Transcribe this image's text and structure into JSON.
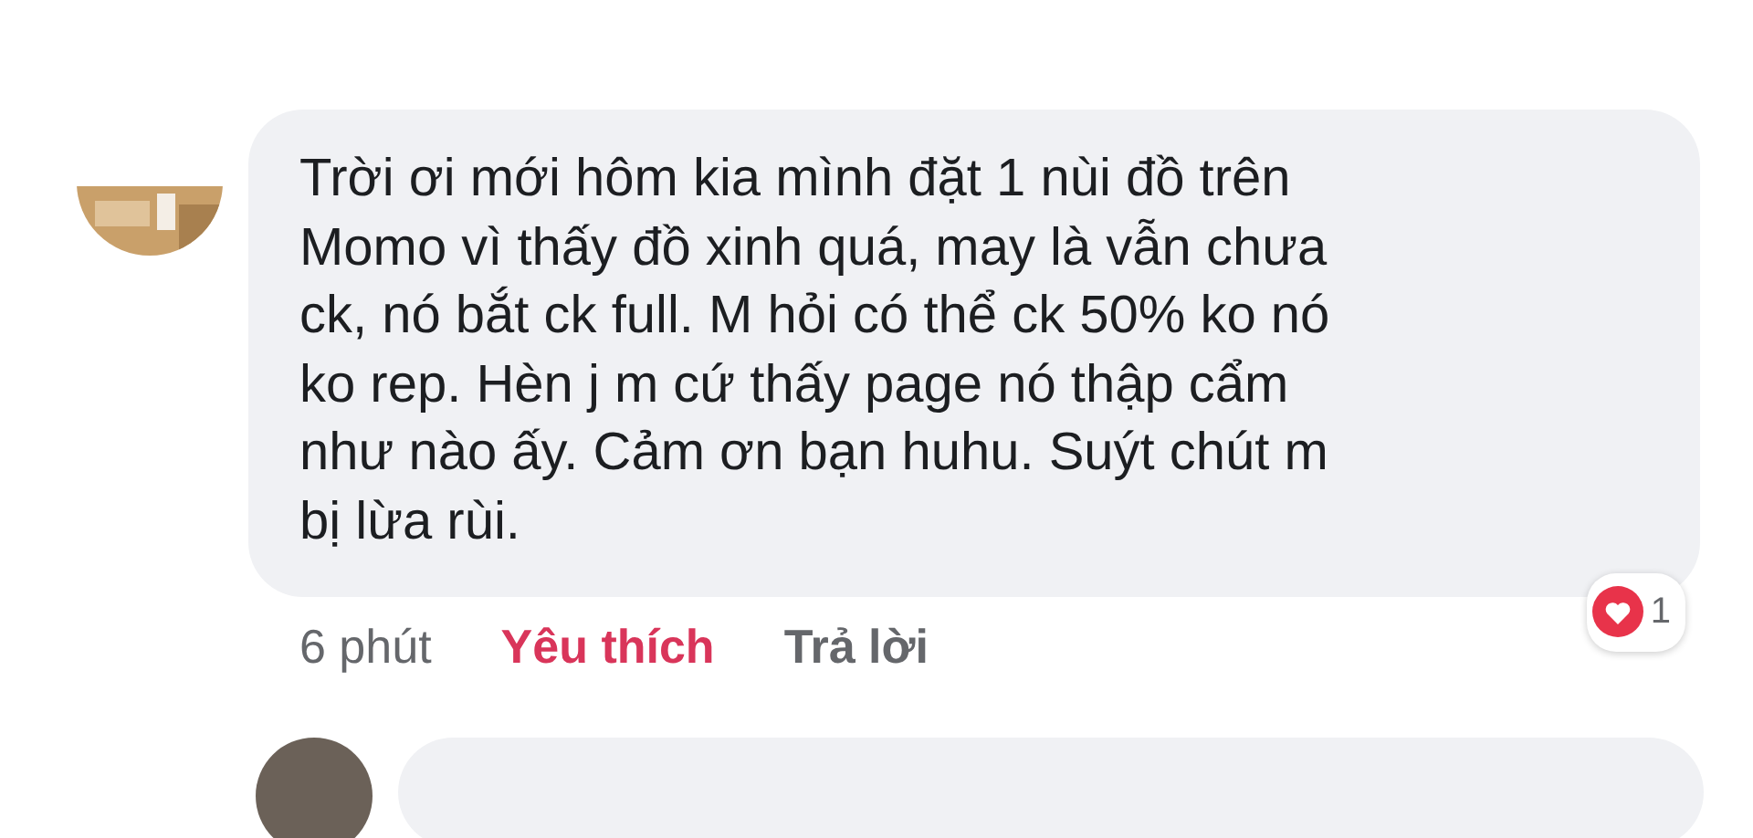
{
  "comment": {
    "lines": [
      "Trời ơi mới hôm kia mình đặt 1 nùi đồ trên",
      "Momo vì thấy đồ xinh quá, may là vẫn chưa",
      "ck, nó bắt ck full. M hỏi có thể ck 50% ko nó",
      "ko rep. Hèn j m cứ thấy page nó thập cẩm",
      "như nào ấy. Cảm ơn bạn huhu. Suýt chút m",
      "bị lừa rùi."
    ],
    "time": "6 phút",
    "like": {
      "label": "Yêu thích",
      "selected": true
    },
    "reply": "Trả lời",
    "reactions": {
      "count": "1"
    }
  }
}
